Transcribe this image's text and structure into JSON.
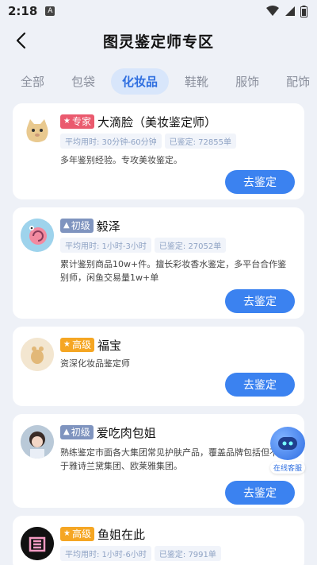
{
  "status_bar": {
    "time": "2:18",
    "notif_letter": "A"
  },
  "header": {
    "title": "图灵鉴定师专区"
  },
  "tabs": [
    "全部",
    "包袋",
    "化妆品",
    "鞋靴",
    "服饰",
    "配饰"
  ],
  "active_tab": "化妆品",
  "experts": [
    {
      "badge": "专家",
      "level": "expert",
      "name": "大滴脸（美妆鉴定师）",
      "avg_time": "平均用时: 30分钟-60分钟",
      "count": "已鉴定: 72855单",
      "desc": "多年鉴别经验。专攻美妆鉴定。",
      "button": "去鉴定",
      "avatar": "cat-avatar"
    },
    {
      "badge": "初级",
      "level": "junior",
      "name": "毅泽",
      "avg_time": "平均用时: 1小时-3小时",
      "count": "已鉴定: 27052单",
      "desc": "累计鉴别商品10w+件。擅长彩妆香水鉴定，多平台合作鉴别师，闲鱼交易量1w+单",
      "button": "去鉴定",
      "avatar": "snail-avatar"
    },
    {
      "badge": "高级",
      "level": "senior",
      "name": "福宝",
      "avg_time": "",
      "count": "",
      "desc": "资深化妆品鉴定师",
      "button": "去鉴定",
      "avatar": "bear-avatar"
    },
    {
      "badge": "初级",
      "level": "junior",
      "name": "爱吃肉包姐",
      "avg_time": "",
      "count": "",
      "desc": "熟练鉴定市面各大集团常见护肤产品，覆盖品牌包括但不限于雅诗兰黛集团、欧莱雅集团。",
      "button": "去鉴定",
      "avatar": "girl-avatar"
    },
    {
      "badge": "高级",
      "level": "senior",
      "name": "鱼姐在此",
      "avg_time": "平均用时: 1小时-6小时",
      "count": "已鉴定: 7991单",
      "desc": "",
      "button": "",
      "avatar": "fish-avatar"
    }
  ],
  "float_service": {
    "label": "在线客服"
  },
  "colors": {
    "primary": "#3b82f0",
    "expert": "#ea5a6e",
    "junior": "#7f94bf",
    "senior": "#f5a623"
  }
}
